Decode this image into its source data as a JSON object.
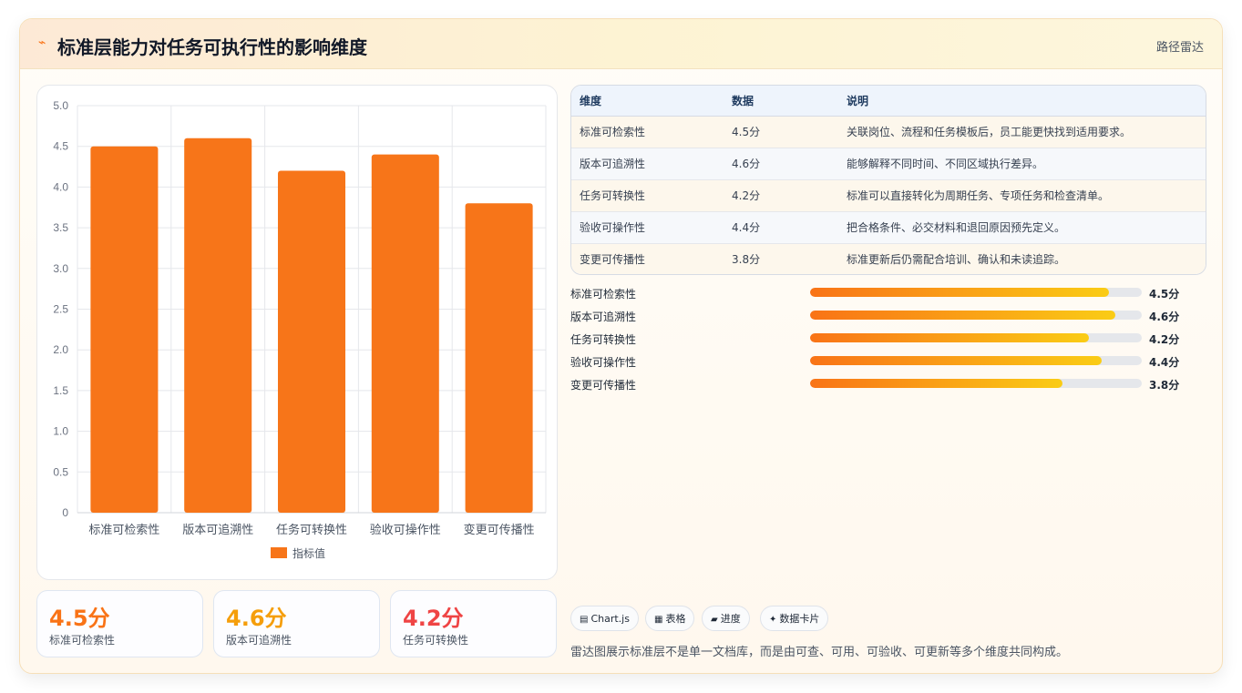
{
  "header": {
    "logo_glyph": "⌁",
    "title": "标准层能力对任务可执行性的影响维度",
    "tag": "路径雷达"
  },
  "chart_data": {
    "type": "bar",
    "categories": [
      "标准可检索性",
      "版本可追溯性",
      "任务可转换性",
      "验收可操作性",
      "变更可传播性"
    ],
    "series": [
      {
        "name": "指标值",
        "values": [
          4.5,
          4.6,
          4.2,
          4.4,
          3.8
        ],
        "color": "#f77519"
      }
    ],
    "ylim": [
      0,
      5
    ],
    "yticks": [
      "0",
      "0.5",
      "1.0",
      "1.5",
      "2.0",
      "2.5",
      "3.0",
      "3.5",
      "4.0",
      "4.5",
      "5.0"
    ],
    "grid": true,
    "legend": "bottom"
  },
  "stats": [
    {
      "value": "4.5分",
      "label": "标准可检索性",
      "color": "#f97316"
    },
    {
      "value": "4.6分",
      "label": "版本可追溯性",
      "color": "#f59e0b"
    },
    {
      "value": "4.2分",
      "label": "任务可转换性",
      "color": "#ef4444"
    }
  ],
  "table": {
    "headers": [
      "维度",
      "数据",
      "说明"
    ],
    "rows": [
      {
        "dim": "标准可检索性",
        "data": "4.5分",
        "desc": "关联岗位、流程和任务模板后，员工能更快找到适用要求。"
      },
      {
        "dim": "版本可追溯性",
        "data": "4.6分",
        "desc": "能够解释不同时间、不同区域执行差异。"
      },
      {
        "dim": "任务可转换性",
        "data": "4.2分",
        "desc": "标准可以直接转化为周期任务、专项任务和检查清单。"
      },
      {
        "dim": "验收可操作性",
        "data": "4.4分",
        "desc": "把合格条件、必交材料和退回原因预先定义。"
      },
      {
        "dim": "变更可传播性",
        "data": "3.8分",
        "desc": "标准更新后仍需配合培训、确认和未读追踪。"
      }
    ]
  },
  "progress": {
    "max": 5,
    "items": [
      {
        "label": "标准可检索性",
        "value": 4.5,
        "text": "4.5分"
      },
      {
        "label": "版本可追溯性",
        "value": 4.6,
        "text": "4.6分"
      },
      {
        "label": "任务可转换性",
        "value": 4.2,
        "text": "4.2分"
      },
      {
        "label": "验收可操作性",
        "value": 4.4,
        "text": "4.4分"
      },
      {
        "label": "变更可传播性",
        "value": 3.8,
        "text": "3.8分"
      }
    ]
  },
  "chips": [
    {
      "icon": "▤",
      "label": "Chart.js"
    },
    {
      "icon": "▦",
      "label": "表格"
    },
    {
      "icon": "▰",
      "label": "进度"
    },
    {
      "icon": "✦",
      "label": "数据卡片"
    }
  ],
  "footnote": "雷达图展示标准层不是单一文档库，而是由可查、可用、可验收、可更新等多个维度共同构成。"
}
